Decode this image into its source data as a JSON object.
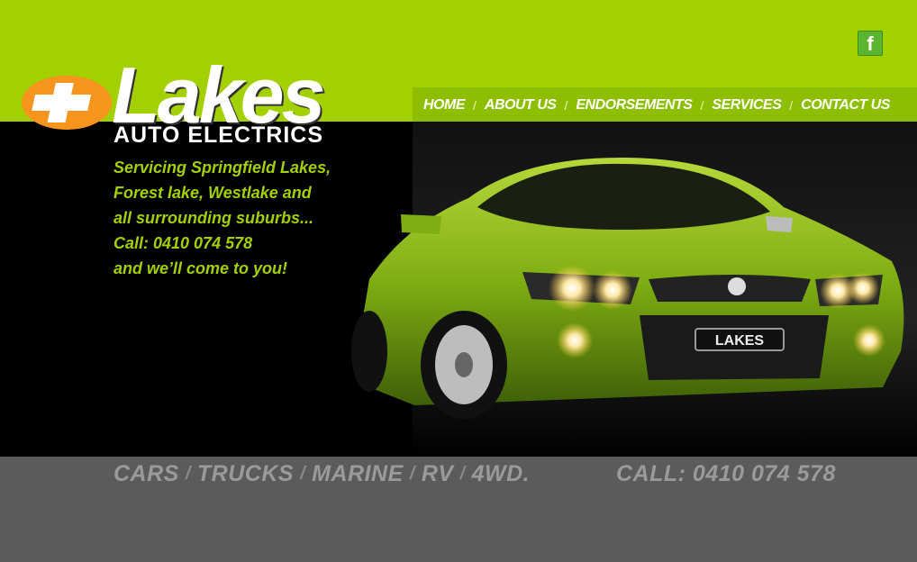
{
  "social": {
    "facebook_glyph": "f",
    "facebook_icon": "facebook-icon"
  },
  "logo": {
    "word": "Lakes",
    "subtitle": "AUTO ELECTRICS",
    "cross_color": "#f7941d"
  },
  "nav": {
    "items": [
      {
        "label": "HOME"
      },
      {
        "label": "ABOUT US"
      },
      {
        "label": "ENDORSEMENTS"
      },
      {
        "label": "SERVICES"
      },
      {
        "label": "CONTACT US"
      }
    ],
    "separator": "/"
  },
  "tagline": {
    "lines": [
      "Servicing Springfield Lakes,",
      "Forest lake, Westlake and",
      "all surrounding suburbs...",
      "Call: 0410 074 578",
      "and we’ll come to you!"
    ]
  },
  "car": {
    "plate": "LAKES"
  },
  "footer": {
    "services": [
      "CARS",
      "TRUCKS",
      "MARINE",
      "RV",
      "4WD."
    ],
    "separator": "/",
    "call": "CALL: 0410 074 578"
  },
  "colors": {
    "brand_green": "#a3d000",
    "nav_band": "#8dbf00",
    "footer_gray": "#5b5b5b",
    "accent_orange": "#f7941d"
  }
}
